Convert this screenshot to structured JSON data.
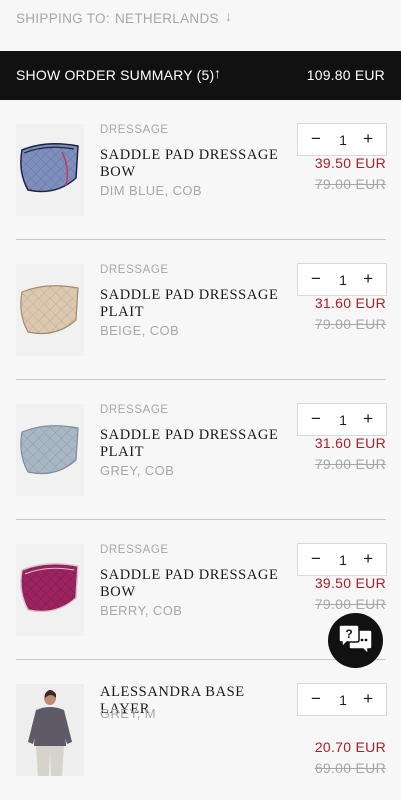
{
  "shipping": {
    "label": "SHIPPING TO:",
    "country": "NETHERLANDS",
    "arrow_icon": "arrow-down-icon"
  },
  "summary": {
    "label": "SHOW ORDER SUMMARY (5)",
    "arrow_icon": "arrow-up-icon",
    "total": "109.80 EUR"
  },
  "items": [
    {
      "category": "DRESSAGE",
      "name": "SADDLE PAD DRESSAGE BOW",
      "variant": "DIM BLUE, COB",
      "qty": "1",
      "price": "39.50 EUR",
      "original_price": "79.00 EUR",
      "image": "saddle-pad-dim-blue"
    },
    {
      "category": "DRESSAGE",
      "name": "SADDLE PAD DRESSAGE PLAIT",
      "variant": "BEIGE, COB",
      "qty": "1",
      "price": "31.60 EUR",
      "original_price": "79.00 EUR",
      "image": "saddle-pad-beige"
    },
    {
      "category": "DRESSAGE",
      "name": "SADDLE PAD DRESSAGE PLAIT",
      "variant": "GREY, COB",
      "qty": "1",
      "price": "31.60 EUR",
      "original_price": "79.00 EUR",
      "image": "saddle-pad-grey"
    },
    {
      "category": "DRESSAGE",
      "name": "SADDLE PAD DRESSAGE BOW",
      "variant": "BERRY, COB",
      "qty": "1",
      "price": "39.50 EUR",
      "original_price": "79.00 EUR",
      "image": "saddle-pad-berry"
    },
    {
      "category": "",
      "name": "ALESSANDRA BASE LAYER",
      "variant": "GREY, M",
      "qty": "1",
      "price": "20.70 EUR",
      "original_price": "69.00 EUR",
      "image": "base-layer-grey"
    }
  ],
  "qty_controls": {
    "minus_symbol": "−",
    "plus_symbol": "+"
  },
  "chat": {
    "icon": "help-chat-icon"
  },
  "colors": {
    "sale_price": "#a5202a",
    "summary_bar": "#111111",
    "muted_text": "#a7a7a7",
    "pad_dim_blue": "#7f8fbd",
    "pad_beige": "#dcc8b0",
    "pad_grey": "#a9b6c4",
    "pad_berry": "#9b2360",
    "base_layer": "#5e5a66"
  }
}
